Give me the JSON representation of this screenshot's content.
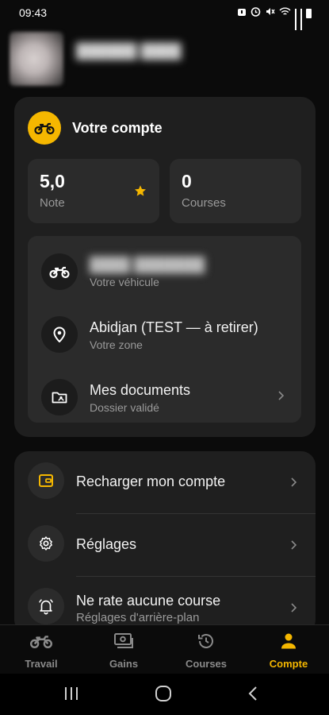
{
  "status_bar": {
    "time": "09:43",
    "icons": [
      "alarm-icon",
      "alarm-clock-icon",
      "mute-icon",
      "wifi-icon",
      "signal-icon",
      "signal-icon",
      "battery-icon"
    ]
  },
  "account": {
    "title": "Votre compte",
    "rating": {
      "value": "5,0",
      "label": "Note"
    },
    "trips": {
      "value": "0",
      "label": "Courses"
    },
    "vehicle": {
      "title": "",
      "subtitle": "Votre véhicule"
    },
    "zone": {
      "title": "Abidjan (TEST — à retirer)",
      "subtitle": "Votre zone"
    },
    "documents": {
      "title": "Mes documents",
      "subtitle": "Dossier validé"
    }
  },
  "menu": {
    "recharge": "Recharger mon compte",
    "settings": "Réglages",
    "notify": {
      "title": "Ne rate aucune course",
      "subtitle": "Réglages d'arrière-plan"
    }
  },
  "bottom_nav": {
    "items": [
      {
        "label": "Travail",
        "icon": "motorbike-icon",
        "active": false
      },
      {
        "label": "Gains",
        "icon": "cash-icon",
        "active": false
      },
      {
        "label": "Courses",
        "icon": "history-icon",
        "active": false
      },
      {
        "label": "Compte",
        "icon": "person-icon",
        "active": true
      }
    ]
  },
  "colors": {
    "accent": "#f5b700",
    "background": "#0b0b0b",
    "card": "#1f1f1f",
    "inner_card": "#2b2b2b"
  }
}
